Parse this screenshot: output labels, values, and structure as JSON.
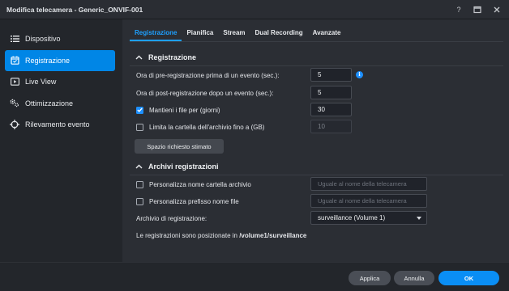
{
  "window": {
    "title": "Modifica telecamera - Generic_ONVIF-001",
    "help": "?"
  },
  "sidebar": {
    "items": [
      {
        "label": "Dispositivo",
        "icon": "list-icon",
        "active": false
      },
      {
        "label": "Registrazione",
        "icon": "calendar-icon",
        "active": true
      },
      {
        "label": "Live View",
        "icon": "play-icon",
        "active": false
      },
      {
        "label": "Ottimizzazione",
        "icon": "settings-icon",
        "active": false
      },
      {
        "label": "Rilevamento evento",
        "icon": "crosshair-icon",
        "active": false
      }
    ]
  },
  "tabs": [
    {
      "label": "Registrazione",
      "active": true
    },
    {
      "label": "Pianifica",
      "active": false
    },
    {
      "label": "Stream",
      "active": false
    },
    {
      "label": "Dual Recording",
      "active": false
    },
    {
      "label": "Avanzate",
      "active": false
    }
  ],
  "section_recording": {
    "title": "Registrazione",
    "pre_label": "Ora di pre-registrazione prima di un evento (sec.):",
    "pre_value": "5",
    "post_label": "Ora di post-registrazione dopo un evento (sec.):",
    "post_value": "5",
    "keep_label": "Mantieni i file per (giorni)",
    "keep_checked": true,
    "keep_value": "30",
    "limit_label": "Limita la cartella dell'archivio fino a (GB)",
    "limit_checked": false,
    "limit_value": "10",
    "estimate_button": "Spazio richiesto stimato"
  },
  "section_archive": {
    "title": "Archivi registrazioni",
    "custom_folder_label": "Personalizza nome cartella archivio",
    "custom_folder_placeholder": "Uguale al nome della telecamera",
    "custom_prefix_label": "Personalizza prefisso nome file",
    "custom_prefix_placeholder": "Uguale al nome della telecamera",
    "archive_label": "Archivio di registrazione:",
    "archive_value": "surveillance (Volume 1)",
    "location_text": "Le registrazioni sono posizionate in",
    "location_path": "/volume1/surveillance"
  },
  "footer": {
    "apply": "Applica",
    "cancel": "Annulla",
    "ok": "OK"
  },
  "colors": {
    "accent": "#0086e6",
    "background": "#2b2e34",
    "sidebar": "#23262b"
  }
}
